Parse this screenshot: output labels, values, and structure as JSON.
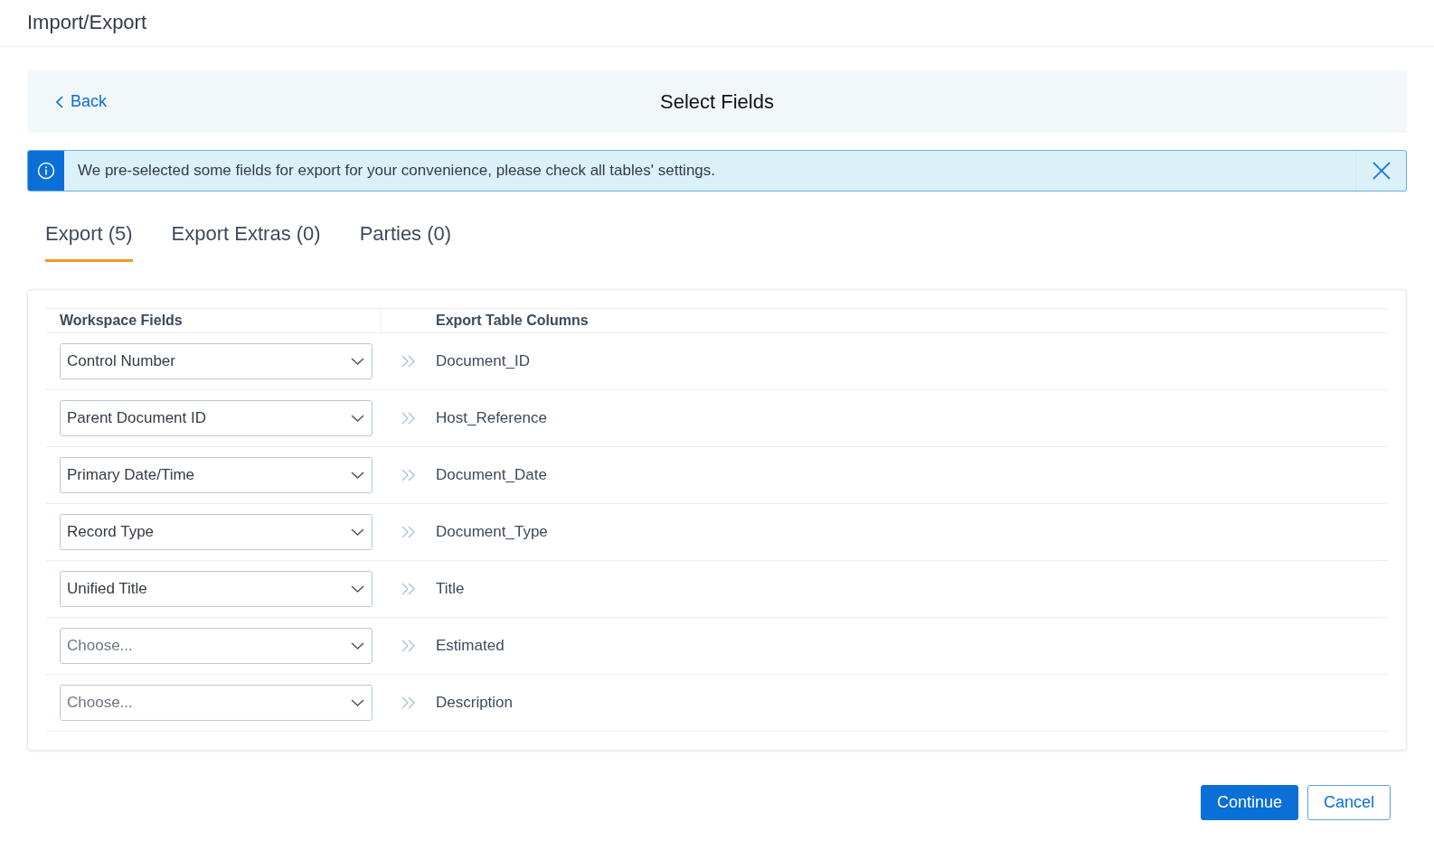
{
  "window": {
    "title": "Import/Export"
  },
  "header": {
    "back": "Back",
    "title": "Select Fields"
  },
  "alert": {
    "message": "We pre-selected some fields for export for your convenience, please check all tables' settings."
  },
  "tabs": [
    {
      "label": "Export (5)",
      "selected": true
    },
    {
      "label": "Export Extras (0)",
      "selected": false
    },
    {
      "label": "Parties (0)",
      "selected": false
    }
  ],
  "table": {
    "columns": [
      "Workspace Fields",
      "Export Table Columns"
    ],
    "rows": [
      {
        "field": "Control Number",
        "column": "Document_ID"
      },
      {
        "field": "Parent Document ID",
        "column": "Host_Reference"
      },
      {
        "field": "Primary Date/Time",
        "column": "Document_Date"
      },
      {
        "field": "Record Type",
        "column": "Document_Type"
      },
      {
        "field": "Unified Title",
        "column": "Title"
      },
      {
        "placeholder": "Choose...",
        "column": "Estimated"
      },
      {
        "placeholder": "Choose...",
        "column": "Description"
      }
    ]
  },
  "buttons": [
    "Continue",
    "Cancel"
  ]
}
